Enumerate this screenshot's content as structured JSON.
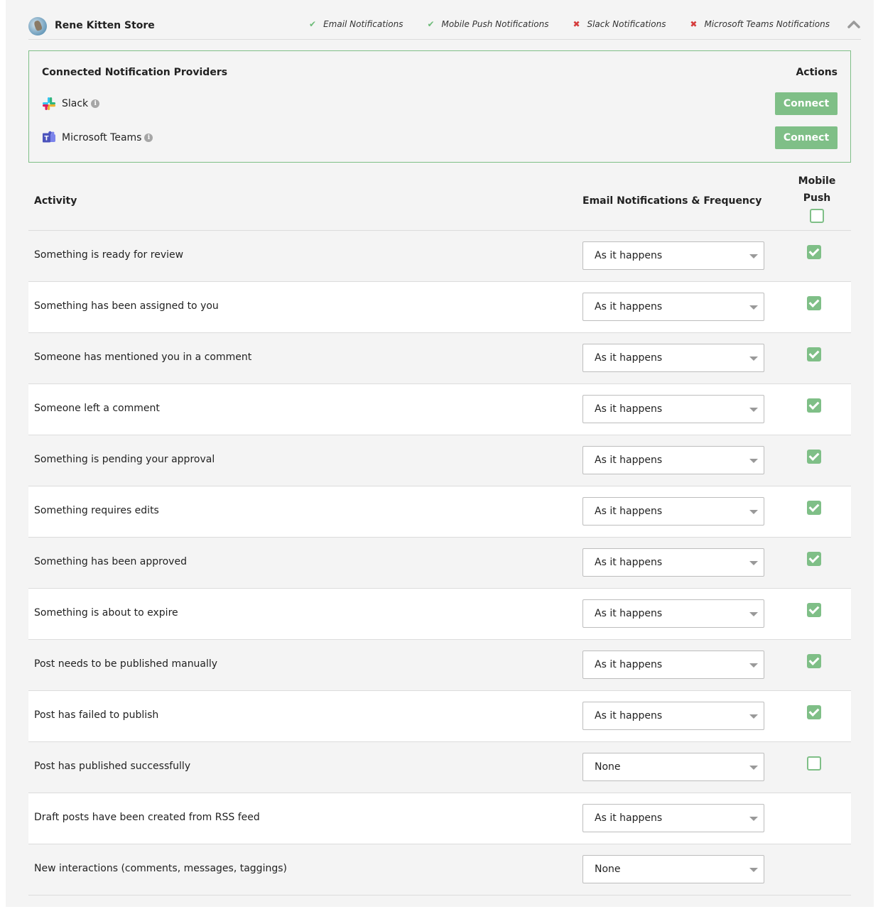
{
  "header": {
    "store_name": "Rene Kitten Store",
    "statuses": [
      {
        "label": "Email Notifications",
        "state": "enabled",
        "icon": "check-icon"
      },
      {
        "label": "Mobile Push Notifications",
        "state": "enabled",
        "icon": "check-icon"
      },
      {
        "label": "Slack Notifications",
        "state": "disabled",
        "icon": "x-icon"
      },
      {
        "label": "Microsoft Teams Notifications",
        "state": "disabled",
        "icon": "x-icon"
      }
    ],
    "collapse_icon": "chevron-up-icon"
  },
  "providers": {
    "title": "Connected Notification Providers",
    "actions_title": "Actions",
    "items": [
      {
        "name": "Slack",
        "icon": "slack-logo-icon",
        "action_label": "Connect"
      },
      {
        "name": "Microsoft Teams",
        "icon": "teams-logo-icon",
        "action_label": "Connect"
      }
    ]
  },
  "table": {
    "headers": {
      "activity": "Activity",
      "email": "Email Notifications & Frequency",
      "mobile_line1": "Mobile",
      "mobile_line2": "Push"
    },
    "mobile_all_checked": false,
    "rows": [
      {
        "activity": "Something is ready for review",
        "frequency": "As it happens",
        "mobile_push": true
      },
      {
        "activity": "Something has been assigned to you",
        "frequency": "As it happens",
        "mobile_push": true
      },
      {
        "activity": "Someone has mentioned you in a comment",
        "frequency": "As it happens",
        "mobile_push": true
      },
      {
        "activity": "Someone left a comment",
        "frequency": "As it happens",
        "mobile_push": true
      },
      {
        "activity": "Something is pending your approval",
        "frequency": "As it happens",
        "mobile_push": true
      },
      {
        "activity": "Something requires edits",
        "frequency": "As it happens",
        "mobile_push": true
      },
      {
        "activity": "Something has been approved",
        "frequency": "As it happens",
        "mobile_push": true
      },
      {
        "activity": "Something is about to expire",
        "frequency": "As it happens",
        "mobile_push": true
      },
      {
        "activity": "Post needs to be published manually",
        "frequency": "As it happens",
        "mobile_push": true
      },
      {
        "activity": "Post has failed to publish",
        "frequency": "As it happens",
        "mobile_push": true
      },
      {
        "activity": "Post has published successfully",
        "frequency": "None",
        "mobile_push": false
      },
      {
        "activity": "Draft posts have been created from RSS feed",
        "frequency": "As it happens",
        "mobile_push": null
      },
      {
        "activity": "New interactions (comments, messages, taggings)",
        "frequency": "None",
        "mobile_push": null
      }
    ]
  },
  "colors": {
    "accent_green": "#7fbf87",
    "ok_green": "#6dbb78",
    "error_red": "#d53b3b",
    "panel_gray": "#f4f4f4"
  }
}
